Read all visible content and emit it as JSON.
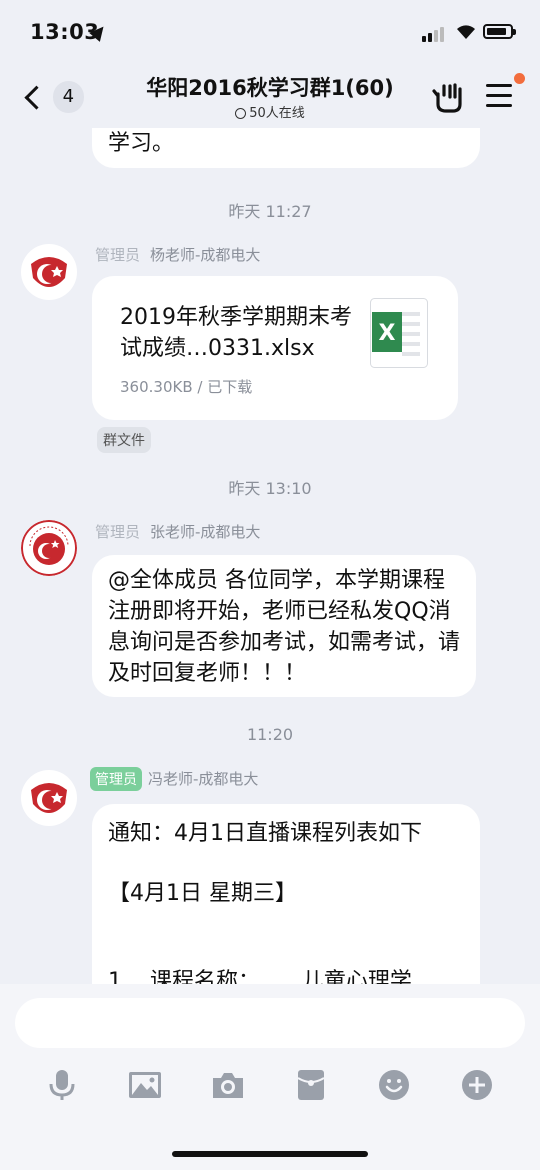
{
  "status": {
    "time": "13:03",
    "battery_level": 0.85
  },
  "nav": {
    "back_count": "4",
    "title": "华阳2016秋学习群1(60)",
    "online": "50人在线"
  },
  "messages": {
    "partial": {
      "text": "学习。"
    },
    "ts1": "昨天 11:27",
    "msg1": {
      "role": "管理员",
      "name": "杨老师-成都电大",
      "file_name": "2019年秋季学期期末考试成绩…0331.xlsx",
      "file_meta": "360.30KB / 已下载",
      "tag": "群文件"
    },
    "ts2": "昨天 13:10",
    "msg2": {
      "role": "管理员",
      "name": "张老师-成都电大",
      "text": "@全体成员 各位同学，本学期课程注册即将开始，老师已经私发QQ消息询问是否参加考试，如需考试，请及时回复老师！！！"
    },
    "ts3": "11:20",
    "msg3": {
      "role": "管理员",
      "name": "冯老师-成都电大",
      "line1": "通知：4月1日直播课程列表如下",
      "line2": "【4月1日 星期三】",
      "line3": "1    课程名称：      儿童心理学"
    }
  },
  "input": {
    "placeholder": ""
  },
  "toolbar": {
    "icons": [
      "microphone-icon",
      "image-icon",
      "camera-icon",
      "red-packet-icon",
      "emoji-icon",
      "plus-icon"
    ]
  },
  "colors": {
    "background": "#eef0f6",
    "badge_green": "#7bcf9b",
    "notify_dot": "#f26d3d",
    "logo_red": "#c7282e"
  }
}
